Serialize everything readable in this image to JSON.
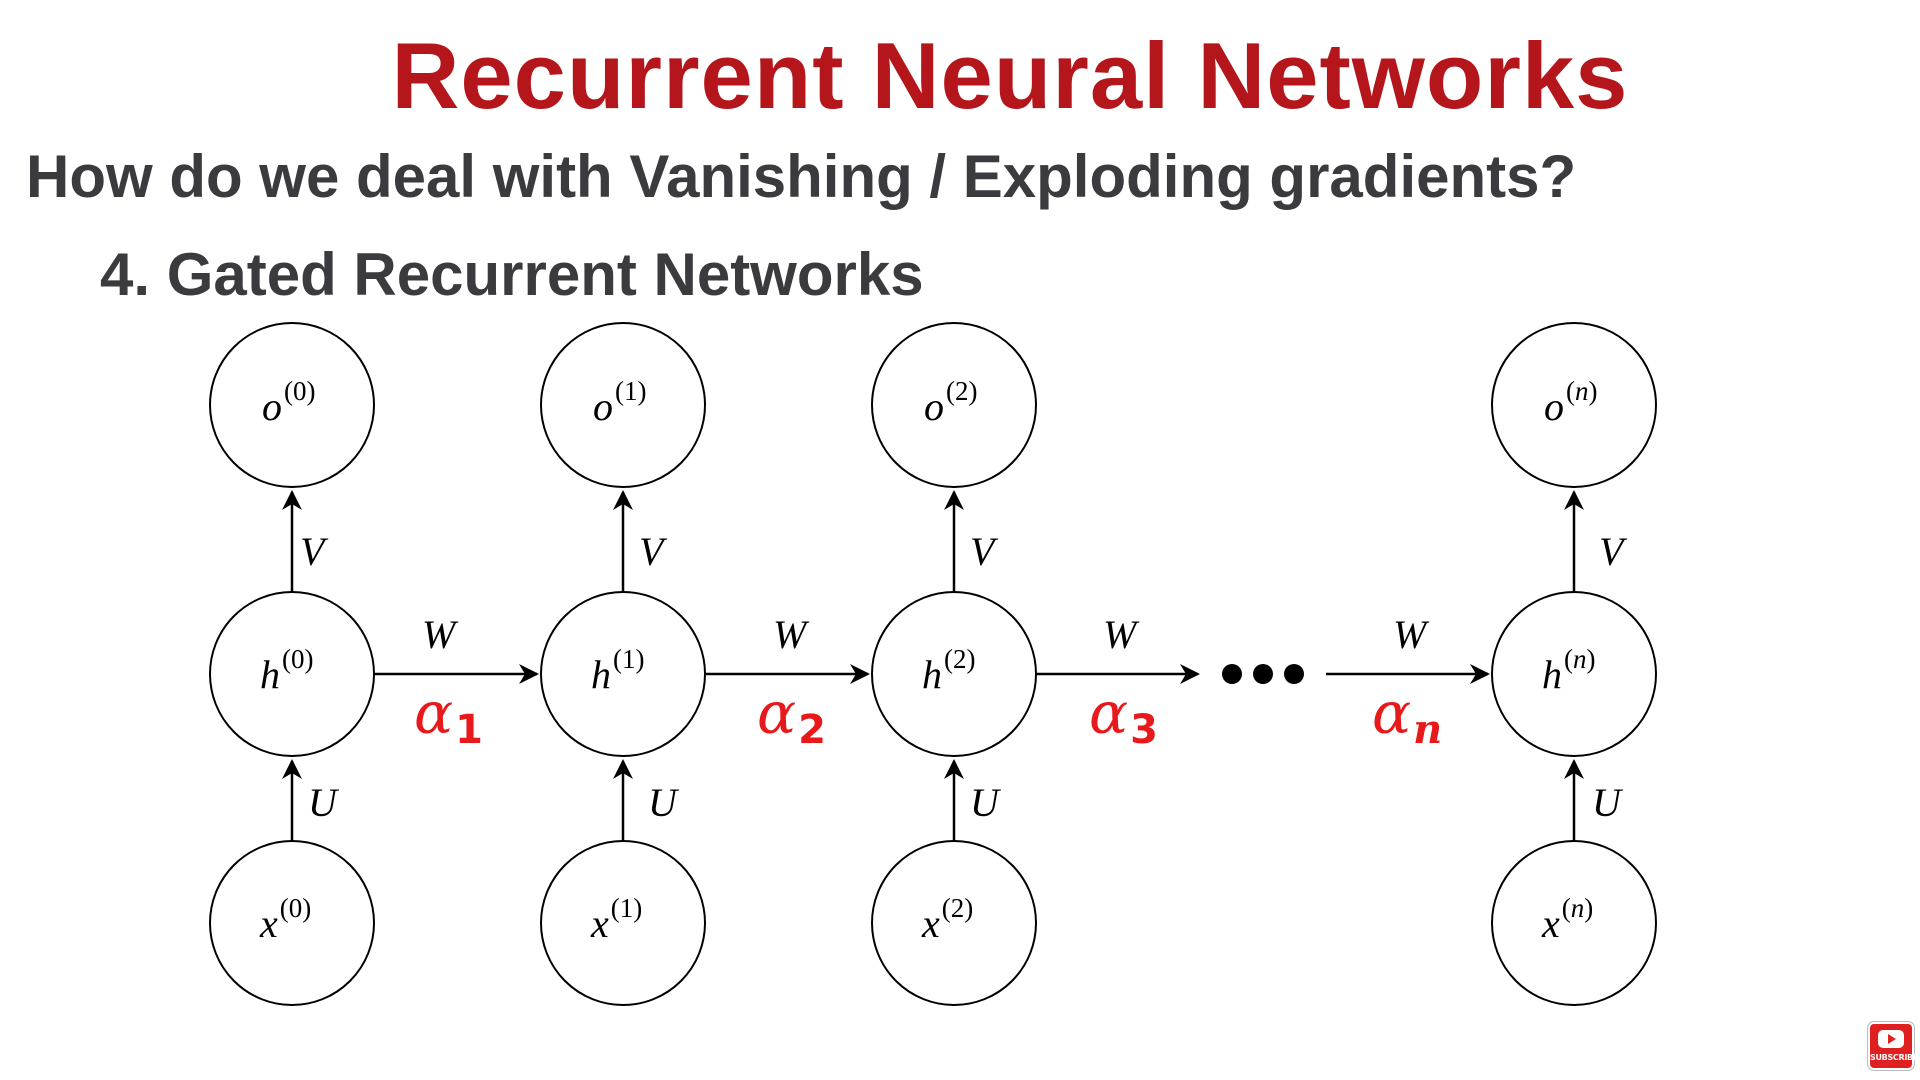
{
  "slide": {
    "title": "Recurrent Neural Networks",
    "subtitle": "How do we deal with Vanishing / Exploding gradients?",
    "section": "4. Gated Recurrent Networks"
  },
  "diagram": {
    "columns": [
      {
        "index": "0",
        "output": "o",
        "hidden": "h",
        "input": "x",
        "output_weight": "V",
        "input_weight": "U"
      },
      {
        "index": "1",
        "output": "o",
        "hidden": "h",
        "input": "x",
        "output_weight": "V",
        "input_weight": "U"
      },
      {
        "index": "2",
        "output": "o",
        "hidden": "h",
        "input": "x",
        "output_weight": "V",
        "input_weight": "U"
      },
      {
        "index": "n",
        "output": "o",
        "hidden": "h",
        "input": "x",
        "output_weight": "V",
        "input_weight": "U"
      }
    ],
    "recurrent_links": [
      {
        "weight": "W",
        "alpha": "α",
        "alpha_sub": "1"
      },
      {
        "weight": "W",
        "alpha": "α",
        "alpha_sub": "2"
      },
      {
        "weight": "W",
        "alpha": "α",
        "alpha_sub": "3"
      },
      {
        "weight": "W",
        "alpha": "α",
        "alpha_sub": "n"
      }
    ],
    "colors": {
      "alpha": "#e8191a",
      "title": "#b5161b",
      "text": "#3a3a3f"
    }
  },
  "badge": {
    "label": "SUBSCRIBE",
    "icon": "youtube-play-icon"
  }
}
